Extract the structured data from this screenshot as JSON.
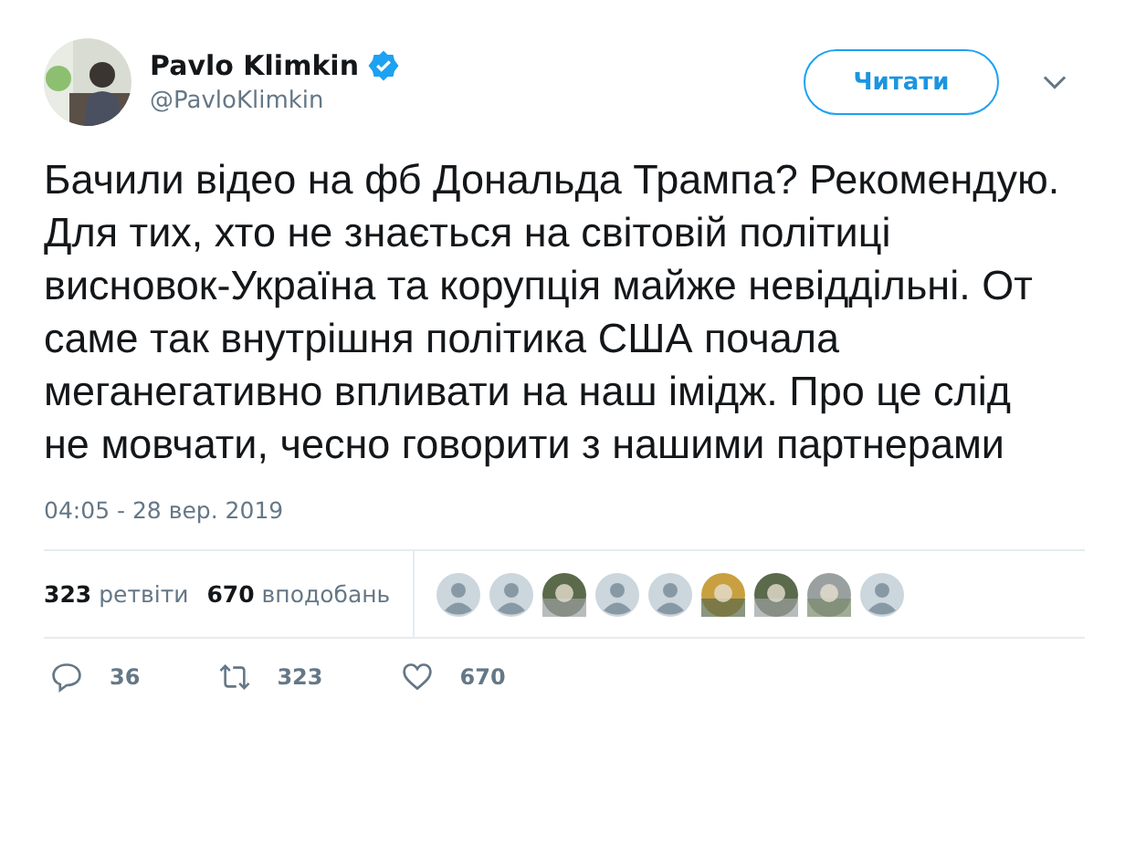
{
  "author": {
    "name": "Pavlo Klimkin",
    "verified": true,
    "handle": "@PavloKlimkin"
  },
  "follow_button": "Читати",
  "tweet_text": "Бачили відео на фб Дональда Трампа? Рекомендую. Для тих, хто не знається на світовій політиці висновок-Україна та корупція майже невіддільні. От саме так внутрішня політика США почала меганегативно впливати на наш імідж. Про це слід не мовчати, чесно говорити з нашими партнерами",
  "timestamp": "04:05 - 28 вер. 2019",
  "stats": [
    {
      "count": "323",
      "label": "ретвіти"
    },
    {
      "count": "670",
      "label": "вподобань"
    }
  ],
  "likers": [
    {
      "kind": "default"
    },
    {
      "kind": "default"
    },
    {
      "kind": "picture"
    },
    {
      "kind": "default"
    },
    {
      "kind": "default"
    },
    {
      "kind": "picture"
    },
    {
      "kind": "picture"
    },
    {
      "kind": "picture"
    },
    {
      "kind": "default"
    }
  ],
  "actions": [
    {
      "kind": "reply",
      "count": "36"
    },
    {
      "kind": "retweet",
      "count": "323"
    },
    {
      "kind": "like",
      "count": "670"
    }
  ]
}
